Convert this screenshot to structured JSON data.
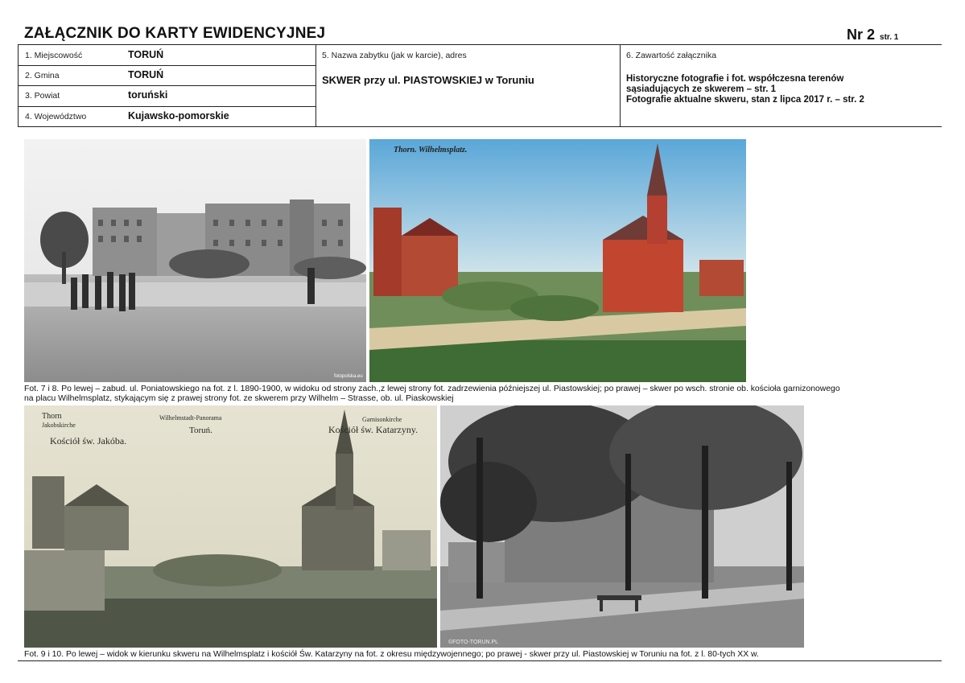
{
  "header": {
    "title": "ZAŁĄCZNIK DO KARTY EWIDENCYJNEJ",
    "nr_label": "Nr 2",
    "page_label": "str. 1"
  },
  "fields": {
    "f1_label": "1. Miejscowość",
    "f1_value": "TORUŃ",
    "f2_label": "2. Gmina",
    "f2_value": "TORUŃ",
    "f3_label": "3. Powiat",
    "f3_value": "toruński",
    "f4_label": "4. Województwo",
    "f4_value": "Kujawsko-pomorskie",
    "f5_label": "5. Nazwa zabytku (jak w karcie), adres",
    "f5_value": "SKWER przy ul. PIASTOWSKIEJ w Toruniu",
    "f6_label": "6. Zawartość załącznika",
    "f6_line1": "Historyczne fotografie i fot. współczesna terenów",
    "f6_line2": "sąsiadujących ze skwerem – str. 1",
    "f6_line3": "Fotografie aktualne skweru, stan z lipca 2017 r. – str. 2"
  },
  "photos": {
    "p7_watermark": "fotopolska.eu",
    "p8_text": "Thorn. Wilhelmsplatz.",
    "p9_text1": "Thorn",
    "p9_text2": "Jakobskirche",
    "p9_text3": "Kościół św. Jakóba.",
    "p9_text4": "Wilhelmstadt-Panorama",
    "p9_text5": "Toruń.",
    "p9_text6": "Garnisonkirche",
    "p9_text7": "Kościół św. Katarzyny.",
    "p10_watermark": "©FOTO-TORUN.PL"
  },
  "captions": {
    "cap1_line1": "Fot. 7 i 8. Po lewej – zabud. ul. Poniatowskiego na fot. z l. 1890-1900, w widoku od strony zach.,z lewej strony fot. zadrzewienia późniejszej ul. Piastowskiej; po prawej – skwer po wsch. stronie ob. kościoła garnizonowego",
    "cap1_line2": "na placu Wilhelmsplatz, stykającym się z prawej strony fot. ze skwerem przy Wilhelm – Strasse, ob. ul. Piaskowskiej",
    "cap2": "Fot. 9 i 10. Po lewej – widok w kierunku skweru na Wilhelmsplatz i kościół Św. Katarzyny na fot. z okresu międzywojennego; po prawej - skwer przy ul. Piastowskiej w Toruniu na fot. z l. 80-tych XX w."
  }
}
